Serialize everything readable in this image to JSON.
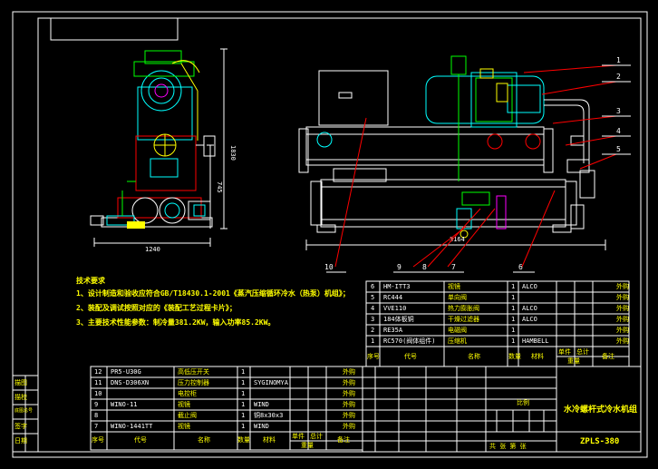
{
  "notes": {
    "title": "技术要求",
    "lines": [
      "1、设计制造和验收应符合GB/T18430.1-2001《蒸汽压缩循环冷水（热泵）机组》；",
      "2、装配及调试按照对应的《装配工艺过程卡片》；",
      "3、主要技术性能参数：制冷量381.2KW，输入功率85.2KW。"
    ]
  },
  "dimensions": {
    "width_bottom": "1240",
    "height_main": "1830",
    "height_inner": "745",
    "length_right": "3164"
  },
  "callouts": [
    "1",
    "2",
    "3",
    "4",
    "5",
    "6",
    "7",
    "8",
    "9",
    "10"
  ],
  "parts_upper": [
    {
      "no": "6",
      "code": "HM-ITT3",
      "name": "视镜",
      "qty": "1",
      "material": "ALCO",
      "note": "外购"
    },
    {
      "no": "5",
      "code": "RC444",
      "name": "单向阀",
      "qty": "1",
      "material": "",
      "note": "外购"
    },
    {
      "no": "4",
      "code": "VVE110",
      "name": "热力膨胀阀",
      "qty": "1",
      "material": "ALCO",
      "note": "外购"
    },
    {
      "no": "3",
      "code": "184体板铜",
      "name": "干燥过滤器",
      "qty": "1",
      "material": "ALCO",
      "note": "外购"
    },
    {
      "no": "2",
      "code": "RE35A",
      "name": "电磁阀",
      "qty": "1",
      "material": "",
      "note": "外购"
    },
    {
      "no": "1",
      "code": "RC570(阀体组件)",
      "name": "压缩机",
      "qty": "1",
      "material": "HAMBELL",
      "note": "外购"
    }
  ],
  "parts_upper_header": {
    "no": "序号",
    "code": "代号",
    "name": "名称",
    "qty": "数量",
    "material": "材料",
    "single": "单件",
    "total": "总计",
    "weight": "重量",
    "remark": "备注"
  },
  "parts_lower": [
    {
      "no": "12",
      "code": "PR5-U30G",
      "name": "高低压开关",
      "qty": "1",
      "material": "",
      "note": "外购"
    },
    {
      "no": "11",
      "code": "DNS-D306XN",
      "name": "压力控制器",
      "qty": "1",
      "material": "SYGINOMYA",
      "note": "外购"
    },
    {
      "no": "10",
      "code": "",
      "name": "电控柜",
      "qty": "1",
      "material": "",
      "note": "外购"
    },
    {
      "no": "9",
      "code": "WINO-11",
      "name": "视镜",
      "qty": "1",
      "material": "WIND",
      "note": "外购"
    },
    {
      "no": "8",
      "code": "",
      "name": "截止阀",
      "qty": "1",
      "material": "铜8x30x3",
      "note": "外购"
    },
    {
      "no": "7",
      "code": "WINO-1441TT",
      "name": "视镜",
      "qty": "1",
      "material": "WIND",
      "note": "外购"
    }
  ],
  "parts_lower_header": {
    "no": "序号",
    "code": "代号",
    "name": "名称",
    "qty": "数量",
    "material": "材料",
    "single": "单件",
    "total": "总计",
    "weight": "重量",
    "remark": "备注"
  },
  "title_block": {
    "product_name": "水冷螺杆式冷水机组",
    "drawing_no": "ZPLS-380",
    "scale_label": "比例",
    "sheet_label": "共 张 第 张"
  },
  "side_stamp": [
    "描图",
    "描校",
    "底图总号",
    "签字",
    "日期"
  ],
  "colors": {
    "line": "#ffffff",
    "cyan": "#00ffff",
    "yellow": "#ffff00",
    "green": "#00ff00",
    "red": "#ff0000",
    "magenta": "#ff00ff",
    "blue": "#4040ff"
  }
}
